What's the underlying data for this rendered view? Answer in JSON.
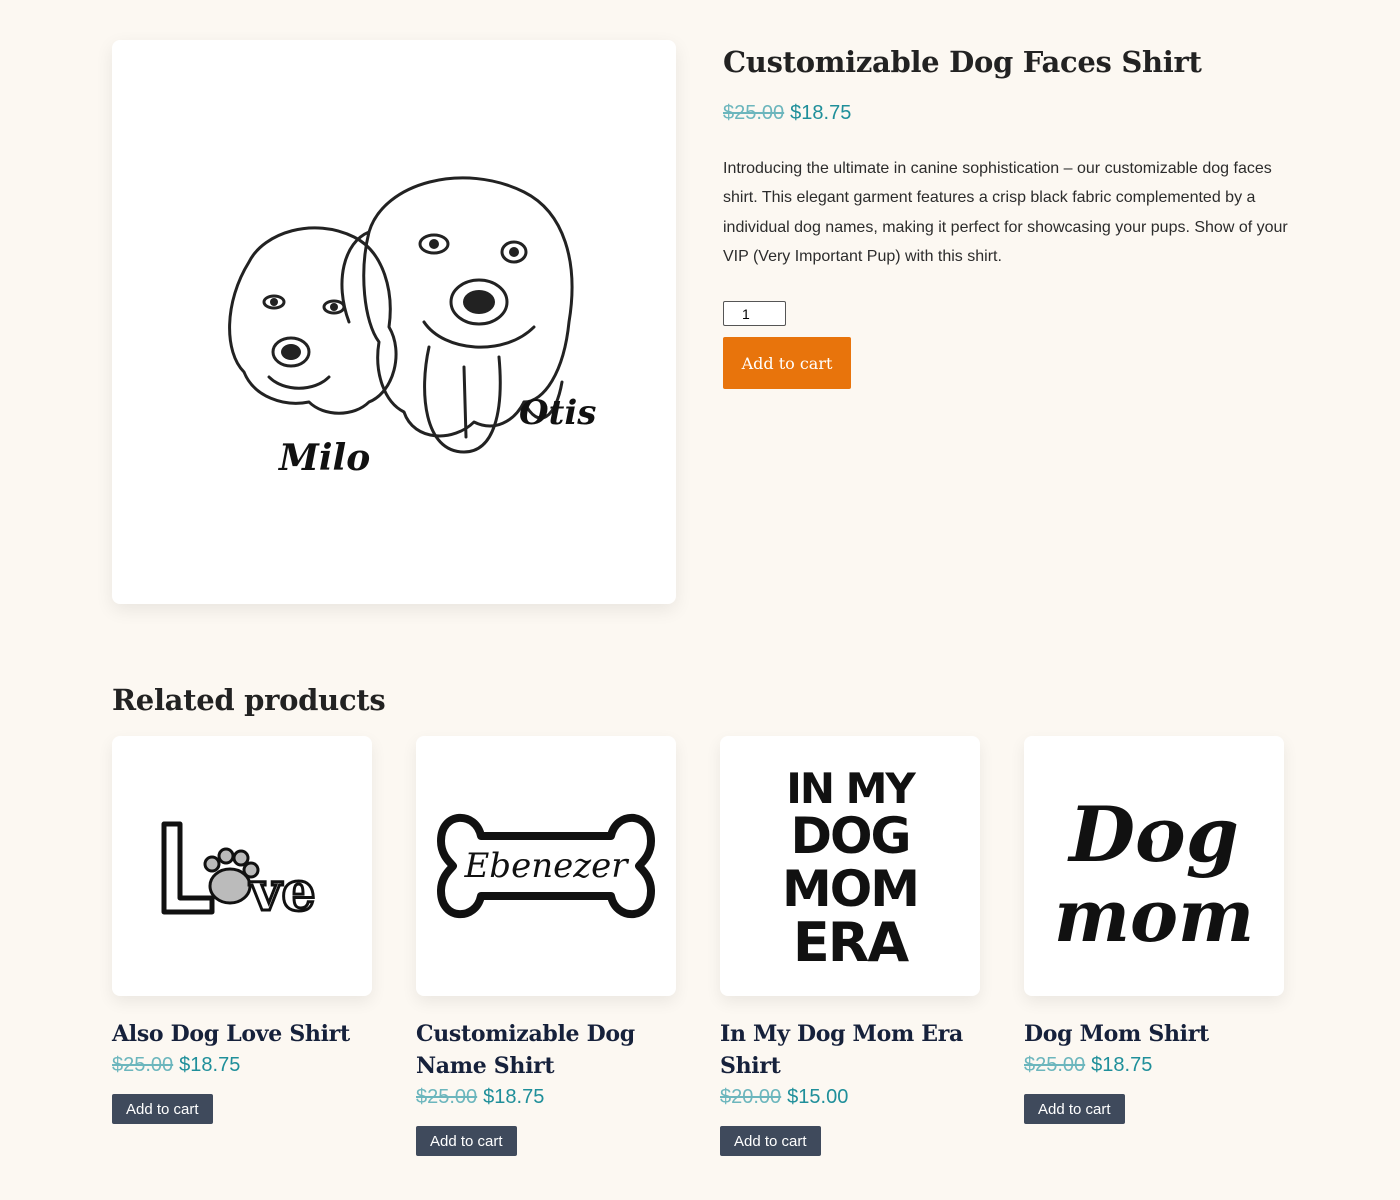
{
  "product": {
    "title": "Customizable Dog Faces Shirt",
    "price_old": "$25.00",
    "price_new": "$18.75",
    "description": "Introducing the ultimate in canine sophistication – our customizable dog faces shirt. This elegant garment features a crisp black fabric complemented by a individual dog names, making it perfect for showcasing your pups. Show of your VIP (Very Important Pup) with this shirt.",
    "quantity": "1",
    "add_to_cart_label": "Add to cart",
    "image_names": [
      "Milo",
      "Otis"
    ]
  },
  "related": {
    "heading": "Related products",
    "items": [
      {
        "title": "Also Dog Love Shirt",
        "price_old": "$25.00",
        "price_new": "$18.75",
        "button": "Add to cart",
        "art_text": "Love"
      },
      {
        "title": "Customizable Dog Name Shirt",
        "price_old": "$25.00",
        "price_new": "$18.75",
        "button": "Add to cart",
        "art_text": "Ebenezer"
      },
      {
        "title": "In My Dog Mom Era Shirt",
        "price_old": "$20.00",
        "price_new": "$15.00",
        "button": "Add to cart",
        "art_text": [
          "IN MY",
          "DOG",
          "MOM",
          "ERA"
        ]
      },
      {
        "title": "Dog Mom Shirt",
        "price_old": "$25.00",
        "price_new": "$18.75",
        "button": "Add to cart",
        "art_text": [
          "Dog",
          "mom"
        ]
      }
    ]
  },
  "colors": {
    "background": "#fcf8f2",
    "price_sale": "#1f8f9a",
    "price_regular": "#6cb6bd",
    "primary_button": "#e8740c",
    "secondary_button": "#3f4a5c"
  }
}
